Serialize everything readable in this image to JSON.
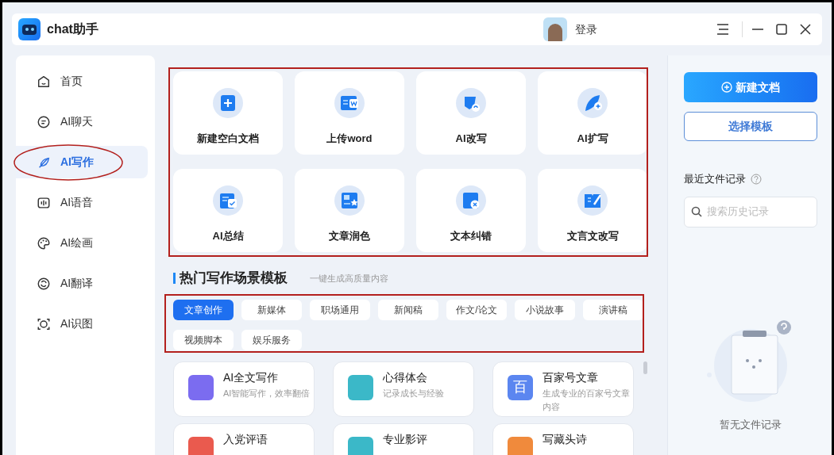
{
  "app": {
    "title": "chat助手",
    "login": "登录"
  },
  "nav": [
    {
      "label": "首页",
      "kind": "home",
      "selected": false
    },
    {
      "label": "AI聊天",
      "kind": "chat",
      "selected": false
    },
    {
      "label": "AI写作",
      "kind": "write",
      "selected": true
    },
    {
      "label": "AI语音",
      "kind": "voice",
      "selected": false
    },
    {
      "label": "AI绘画",
      "kind": "paint",
      "selected": false
    },
    {
      "label": "AI翻译",
      "kind": "translate",
      "selected": false
    },
    {
      "label": "AI识图",
      "kind": "vision",
      "selected": false
    }
  ],
  "tools": [
    {
      "label": "新建空白文档",
      "kind": "plus"
    },
    {
      "label": "上传word",
      "kind": "word"
    },
    {
      "label": "AI改写",
      "kind": "pen"
    },
    {
      "label": "AI扩写",
      "kind": "feather"
    },
    {
      "label": "AI总结",
      "kind": "check"
    },
    {
      "label": "文章润色",
      "kind": "star"
    },
    {
      "label": "文本纠错",
      "kind": "cross"
    },
    {
      "label": "文言文改写",
      "kind": "book"
    }
  ],
  "section": {
    "title": "热门写作场景模板",
    "subtitle": "一键生成高质量内容"
  },
  "categories": [
    {
      "label": "文章创作",
      "selected": true
    },
    {
      "label": "新媒体",
      "selected": false
    },
    {
      "label": "职场通用",
      "selected": false
    },
    {
      "label": "新闻稿",
      "selected": false
    },
    {
      "label": "作文/论文",
      "selected": false
    },
    {
      "label": "小说故事",
      "selected": false
    },
    {
      "label": "演讲稿",
      "selected": false
    },
    {
      "label": "视频脚本",
      "selected": false
    },
    {
      "label": "娱乐服务",
      "selected": false
    }
  ],
  "templates": [
    {
      "title": "AI全文写作",
      "description": "AI智能写作，效率翻倍",
      "color": "#7b6cf0"
    },
    {
      "title": "心得体会",
      "description": "记录成长与经验",
      "color": "#3bb8c8"
    },
    {
      "title": "百家号文章",
      "description": "生成专业的百家号文章内容",
      "color": "#5b86f0",
      "icon_text": "百"
    },
    {
      "title": "入党评语",
      "color": "#ea5a4e"
    },
    {
      "title": "专业影评",
      "color": "#3bb8c8"
    },
    {
      "title": "写藏头诗",
      "color": "#f08a3c"
    }
  ],
  "right": {
    "new_doc": "新建文档",
    "choose_template": "选择模板",
    "recent_label": "最近文件记录",
    "search_placeholder": "搜索历史记录",
    "empty": "暂无文件记录"
  }
}
